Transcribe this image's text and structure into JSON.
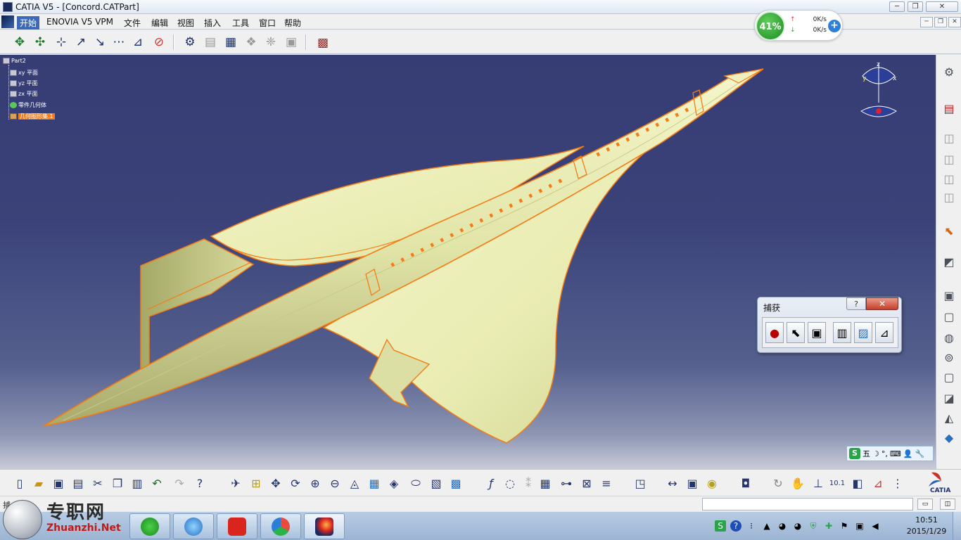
{
  "window": {
    "title": "CATIA V5 - [Concord.CATPart]",
    "minimize": "─",
    "maximize": "❐",
    "close": "✕"
  },
  "menu": {
    "items": [
      "开始",
      "ENOVIA V5 VPM",
      "文件",
      "编辑",
      "视图",
      "插入",
      "工具",
      "窗口",
      "帮助"
    ],
    "mdi_minimize": "─",
    "mdi_restore": "❐",
    "mdi_close": "✕"
  },
  "netmon": {
    "percent": "41%",
    "upload": "0K/s",
    "download": "0K/s",
    "add": "+"
  },
  "tree": {
    "root": "Part2",
    "items": [
      {
        "label": "xy 平面",
        "icon": "plane-icon"
      },
      {
        "label": "yz 平面",
        "icon": "plane-icon"
      },
      {
        "label": "zx 平面",
        "icon": "plane-icon"
      },
      {
        "label": "零件几何体",
        "icon": "geometry-icon"
      },
      {
        "label": "几何图形集.1",
        "icon": "body-icon",
        "selected": true
      }
    ]
  },
  "compass": {
    "x": "x",
    "y": "y",
    "z": "z"
  },
  "capture": {
    "title": "捕获",
    "help": "?",
    "close": "✕",
    "buttons": [
      "record-icon",
      "select-icon",
      "options-icon",
      "album-icon",
      "image-icon",
      "capture-settings-icon"
    ]
  },
  "ime": {
    "logo": "S",
    "mode": "五",
    "items": [
      "☽",
      "°,",
      "⌨",
      "👤",
      "🔧"
    ]
  },
  "statusbar": {
    "text": "捕",
    "command_placeholder": ""
  },
  "watermark": {
    "cn": "专职网",
    "en": "Zhuanzhi.Net"
  },
  "clock": {
    "time": "10:51",
    "date": "2015/1/29"
  },
  "colors": {
    "viewport_top": "#363d74",
    "aircraft_fill": "#ecefb7",
    "edge_highlight": "#f57b14",
    "accent": "#3d6ab8"
  }
}
